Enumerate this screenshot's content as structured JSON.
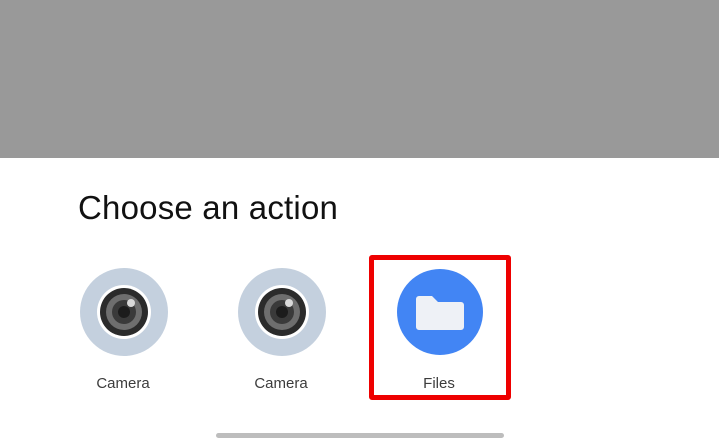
{
  "sheet": {
    "title": "Choose an action"
  },
  "apps": [
    {
      "label": "Camera",
      "icon": "camera-icon"
    },
    {
      "label": "Camera",
      "icon": "camera-icon"
    },
    {
      "label": "Files",
      "icon": "folder-icon"
    }
  ],
  "highlight": {
    "target": "Files",
    "color": "#ee0000"
  },
  "colors": {
    "scrim": "#999999",
    "sheet_background": "#ffffff",
    "camera_ring": "#c4d0de",
    "files_blue": "#4285f4",
    "nav_handle": "#bdbdbd"
  }
}
